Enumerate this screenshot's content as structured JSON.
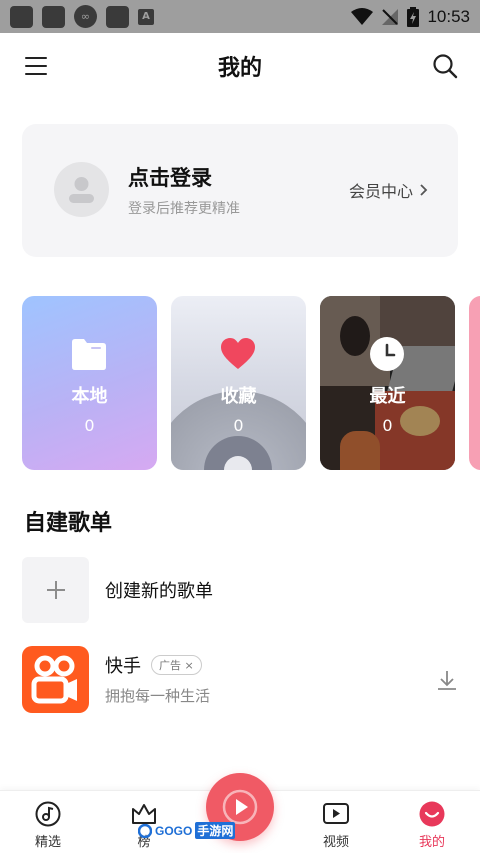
{
  "status_bar": {
    "time": "10:53",
    "badge_letter": "A",
    "infinity_glyph": "∞"
  },
  "header": {
    "title": "我的"
  },
  "login_card": {
    "title": "点击登录",
    "subtitle": "登录后推荐更精准",
    "vip_center": "会员中心"
  },
  "tiles": [
    {
      "label": "本地",
      "count": "0"
    },
    {
      "label": "收藏",
      "count": "0"
    },
    {
      "label": "最近",
      "count": "0"
    }
  ],
  "playlists": {
    "section_title": "自建歌单",
    "create_label": "创建新的歌单"
  },
  "ad": {
    "name": "快手",
    "badge": "广告",
    "badge_close": "×",
    "desc": "拥抱每一种生活"
  },
  "bottom_nav": {
    "items": [
      {
        "label": "精选"
      },
      {
        "label": "榜"
      },
      {
        "label": "视频"
      },
      {
        "label": "我的"
      }
    ]
  },
  "watermark": {
    "text1": "GOGO",
    "text2": "手游网"
  },
  "colors": {
    "accent": "#e8385a",
    "fab": "#f05a65",
    "kuaishou": "#ff5a1f"
  }
}
